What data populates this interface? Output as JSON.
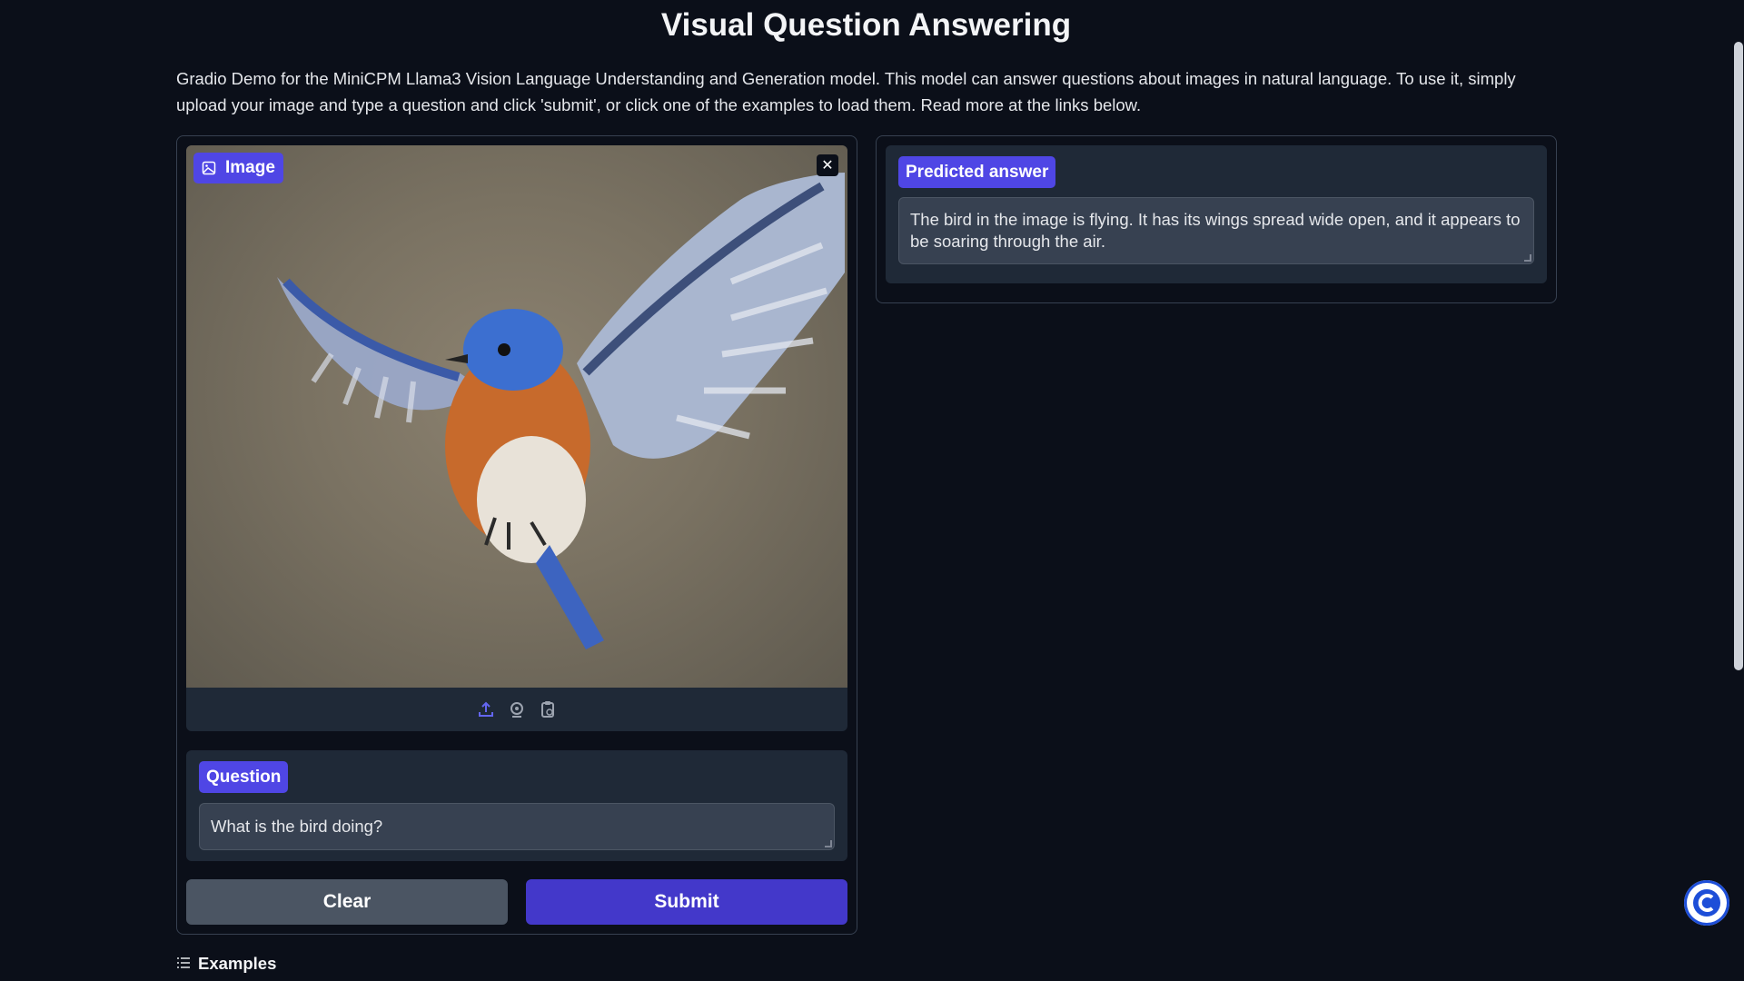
{
  "header": {
    "title": "Visual Question Answering",
    "description": "Gradio Demo for the MiniCPM Llama3 Vision Language Understanding and Generation model. This model can answer questions about images in natural language. To use it, simply upload your image and type a question and click 'submit', or click one of the examples to load them. Read more at the links below."
  },
  "image_input": {
    "label": "Image",
    "label_icon": "image-icon",
    "clear_icon": "close-icon",
    "sources": [
      "upload-icon",
      "webcam-icon",
      "clipboard-icon"
    ]
  },
  "question": {
    "label": "Question",
    "value": "What is the bird doing?"
  },
  "buttons": {
    "clear_label": "Clear",
    "submit_label": "Submit"
  },
  "answer": {
    "label": "Predicted answer",
    "value": "The bird in the image is flying. It has its wings spread wide open, and it appears to be soaring through the air."
  },
  "examples": {
    "label": "Examples",
    "icon": "list-icon"
  },
  "colors": {
    "background": "#0b0f19",
    "panel": "#1f2937",
    "accent": "#4f46e5",
    "submit": "#4338ca",
    "clear": "#4b5563"
  }
}
